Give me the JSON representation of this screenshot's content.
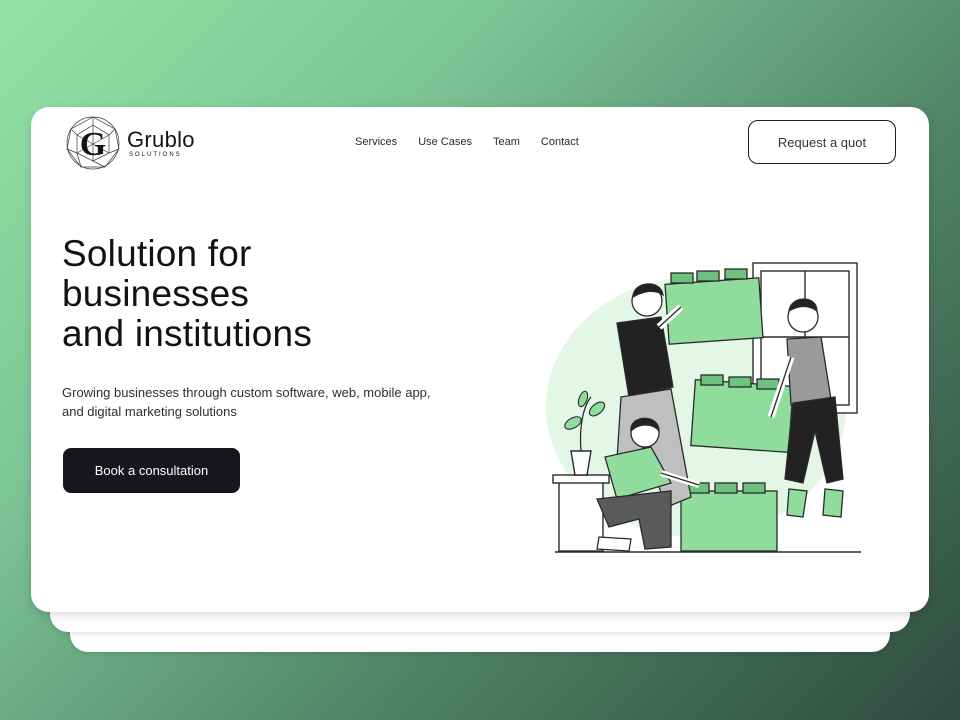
{
  "brand": {
    "name": "Grublo",
    "tagline": "SOLUTIONS",
    "logo_letter": "G"
  },
  "nav": {
    "items": [
      "Services",
      "Use Cases",
      "Team",
      "Contact"
    ]
  },
  "header": {
    "quote_button": "Request a quot"
  },
  "hero": {
    "title_line1": "Solution for",
    "title_line2": "businesses",
    "title_line3": "and institutions",
    "description_line1": "Growing businesses through custom software, web, mobile app,",
    "description_line2": "and digital marketing solutions",
    "cta_label": "Book a consultation"
  },
  "colors": {
    "accent_green": "#8fdc9c",
    "dark_button": "#16161d",
    "background_gradient": [
      "#93e3a6",
      "#2f4a40"
    ]
  },
  "icons": [
    "logo-polyhedron-icon",
    "team-building-blocks-illustration"
  ]
}
